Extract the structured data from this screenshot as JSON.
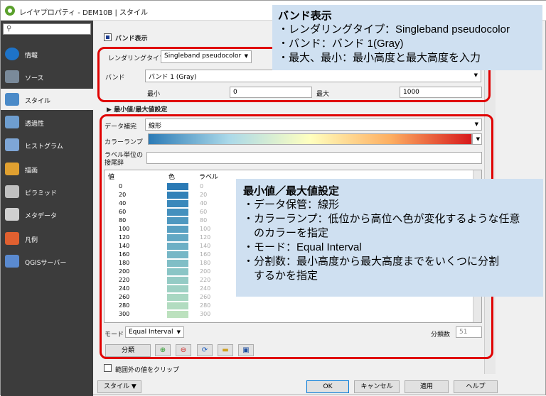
{
  "window": {
    "title": "レイヤプロパティ - DEM10B | スタイル"
  },
  "sidebar": {
    "search_icon": "⚲",
    "items": [
      {
        "label": "情報",
        "icon": "info-icon",
        "color": "#1e73c8"
      },
      {
        "label": "ソース",
        "icon": "source-icon",
        "color": "#7a8a9a"
      },
      {
        "label": "スタイル",
        "icon": "style-icon",
        "color": "#4a8ac8"
      },
      {
        "label": "透過性",
        "icon": "transparency-icon",
        "color": "#6e9ed0"
      },
      {
        "label": "ヒストグラム",
        "icon": "histogram-icon",
        "color": "#7ea6d6"
      },
      {
        "label": "描画",
        "icon": "render-icon",
        "color": "#e0a030"
      },
      {
        "label": "ピラミッド",
        "icon": "pyramid-icon",
        "color": "#c0c0c0"
      },
      {
        "label": "メタデータ",
        "icon": "metadata-icon",
        "color": "#d0d0d0"
      },
      {
        "label": "凡例",
        "icon": "legend-icon",
        "color": "#e06030"
      },
      {
        "label": "QGISサーバー",
        "icon": "server-icon",
        "color": "#5a8ad0"
      }
    ]
  },
  "band": {
    "section_title": "バンド表示",
    "render_type_label": "レンダリングタイプ",
    "render_type_value": "Singleband pseudocolor",
    "band_label": "バンド",
    "band_value": "バンド 1 (Gray)",
    "min_label": "最小",
    "min_value": "0",
    "max_label": "最大",
    "max_value": "1000"
  },
  "minmax_section": "最小値/最大値設定",
  "classify": {
    "interp_label": "データ補完",
    "interp_value": "線形",
    "ramp_label": "カラーランプ",
    "unit_label_1": "ラベル単位の",
    "unit_label_2": "接尾辞",
    "col_value": "値",
    "col_color": "色",
    "col_label": "ラベル",
    "rows": [
      {
        "v": "0",
        "c": "#2a7ab5"
      },
      {
        "v": "20",
        "c": "#3181b8"
      },
      {
        "v": "40",
        "c": "#3a88bb"
      },
      {
        "v": "60",
        "c": "#4490be"
      },
      {
        "v": "80",
        "c": "#4e98c0"
      },
      {
        "v": "100",
        "c": "#58a0c2"
      },
      {
        "v": "120",
        "c": "#62a8c4"
      },
      {
        "v": "140",
        "c": "#6cafc5"
      },
      {
        "v": "160",
        "c": "#76b7c6"
      },
      {
        "v": "180",
        "c": "#80bec6"
      },
      {
        "v": "200",
        "c": "#8ac5c6"
      },
      {
        "v": "220",
        "c": "#94cbc5"
      },
      {
        "v": "240",
        "c": "#9ed1c4"
      },
      {
        "v": "260",
        "c": "#a8d7c2"
      },
      {
        "v": "280",
        "c": "#b2dcc0"
      },
      {
        "v": "300",
        "c": "#bce1be"
      }
    ],
    "mode_label": "モード",
    "mode_value": "Equal Interval",
    "classes_label": "分類数",
    "classes_value": "51",
    "classify_button": "分類"
  },
  "clip_label": "範囲外の値をクリップ",
  "footer": {
    "style_button": "スタイル",
    "ok": "OK",
    "cancel": "キャンセル",
    "apply": "適用",
    "help": "ヘルプ"
  },
  "callout_band": {
    "title": "バンド表示",
    "lines": [
      "・レンダリングタイプ：Singleband pseudocolor",
      "・バンド：バンド 1(Gray)",
      "・最大、最小：最小高度と最大高度を入力"
    ]
  },
  "callout_minmax": {
    "title": "最小値／最大値設定",
    "lines": [
      "・データ保管：線形",
      "・カラーランプ：低位から高位へ色が変化するような任意",
      "　のカラーを指定",
      "・モード：Equal Interval",
      "・分割数：最小高度から最大高度までをいくつに分割",
      "　するかを指定"
    ]
  }
}
